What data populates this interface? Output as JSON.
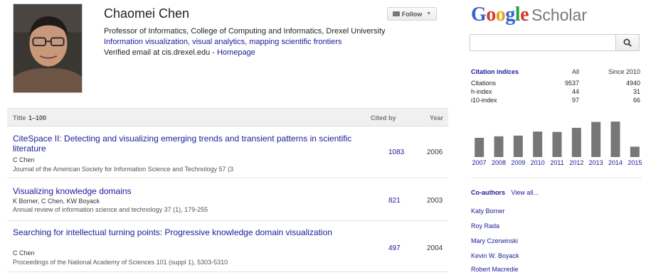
{
  "profile": {
    "name": "Chaomei Chen",
    "affiliation": "Professor of Informatics, College of Computing and Informatics, Drexel University",
    "interests": "Information visualization, visual analytics, mapping scientific frontiers",
    "verified_email": "Verified email at cis.drexel.edu",
    "separator": "-",
    "homepage_label": "Homepage",
    "follow_label": "Follow",
    "mail_icon": "mail-icon",
    "caret_icon": "chevron-down-icon"
  },
  "articles": {
    "header": {
      "title": "Title",
      "range": "1–100",
      "cited_by": "Cited by",
      "year": "Year"
    },
    "rows": [
      {
        "title": "CiteSpace II: Detecting and visualizing emerging trends and transient patterns in scientific literature",
        "authors": "C Chen",
        "venue": "Journal of the American Society for Information Science and Technology 57 (3",
        "cited_by": "1083",
        "year": "2006"
      },
      {
        "title": "Visualizing knowledge domains",
        "authors": "K Borner, C Chen, KW Boyack",
        "venue": "Annual review of information science and technology 37 (1), 179-255",
        "cited_by": "821",
        "year": "2003"
      },
      {
        "title": "Searching for intellectual turning points: Progressive knowledge domain visualization",
        "authors": "C Chen",
        "venue": "Proceedings of the National Academy of Sciences 101 (suppl 1), 5303-5310",
        "cited_by": "497",
        "year": "2004"
      }
    ]
  },
  "brand": {
    "logo": [
      "G",
      "o",
      "o",
      "g",
      "l",
      "e"
    ],
    "scholar": "Scholar",
    "search_icon": "search-icon"
  },
  "citations": {
    "header": {
      "label": "Citation indices",
      "all": "All",
      "since": "Since 2010"
    },
    "rows": [
      {
        "label": "Citations",
        "all": "9537",
        "since": "4940"
      },
      {
        "label": "h-index",
        "all": "44",
        "since": "31"
      },
      {
        "label": "i10-index",
        "all": "97",
        "since": "66"
      }
    ]
  },
  "chart_data": {
    "type": "bar",
    "categories": [
      "2007",
      "2008",
      "2009",
      "2010",
      "2011",
      "2012",
      "2013",
      "2014",
      "2015"
    ],
    "values": [
      520,
      560,
      580,
      690,
      680,
      790,
      950,
      960,
      280
    ],
    "ylim": [
      0,
      1000
    ],
    "color": "#777777",
    "grid": false
  },
  "coauthors": {
    "heading": "Co-authors",
    "view_all": "View all...",
    "names": [
      "Katy Borner",
      "Roy Rada",
      "Mary Czerwinski",
      "Kevin W. Boyack",
      "Robert Macredie"
    ]
  }
}
